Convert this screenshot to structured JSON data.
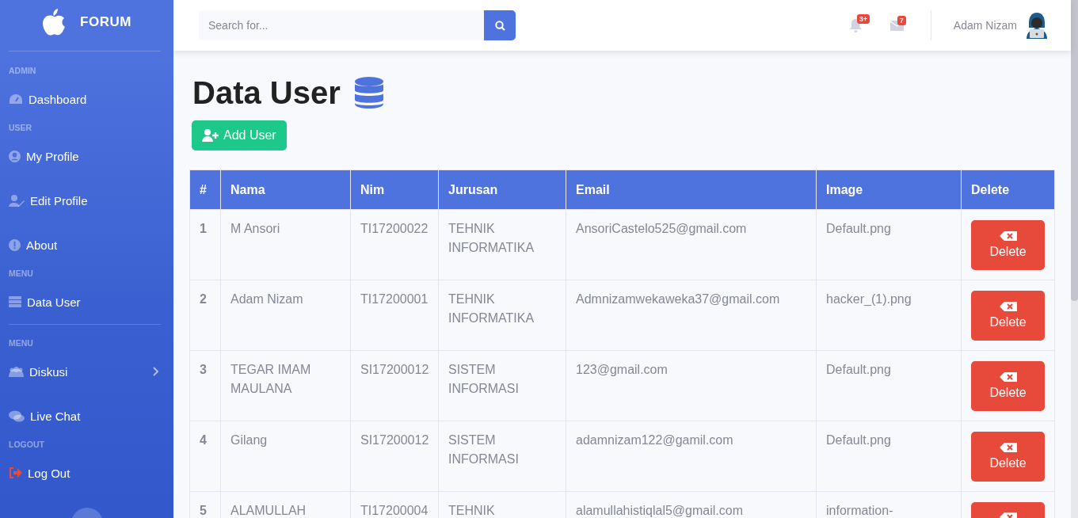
{
  "sidebar": {
    "brand": "FORUM",
    "sections": [
      {
        "heading": "ADMIN",
        "items": [
          {
            "label": "Dashboard",
            "kind": "link"
          }
        ]
      },
      {
        "heading": "USER",
        "items": [
          {
            "label": "My Profile",
            "kind": "link"
          },
          {
            "label": "Edit Profile",
            "kind": "link"
          },
          {
            "label": "About",
            "kind": "link"
          }
        ]
      },
      {
        "heading": "MENU",
        "items": [
          {
            "label": "Data User",
            "kind": "link"
          }
        ],
        "divider_after": true
      },
      {
        "heading": "MENU",
        "items": [
          {
            "label": "Diskusi",
            "kind": "collapsible"
          },
          {
            "label": "Live Chat",
            "kind": "link"
          }
        ]
      },
      {
        "heading": "LOGOUT",
        "items": [
          {
            "label": "Log Out",
            "kind": "logout"
          }
        ]
      }
    ]
  },
  "topbar": {
    "search": {
      "placeholder": "Search for..."
    },
    "alerts_badge": "3+",
    "messages_badge": "7",
    "user_name": "Adam Nizam"
  },
  "page": {
    "title": "Data User",
    "add_button": "Add User"
  },
  "table": {
    "columns": [
      "#",
      "Nama",
      "Nim",
      "Jurusan",
      "Email",
      "Image",
      "Delete"
    ],
    "rows": [
      {
        "cells": [
          "1",
          "M Ansori",
          "TI17200022",
          "TEHNIK INFORMATIKA",
          "AnsoriCastelo525@gmail.com",
          "Default.png"
        ],
        "delete_label": "Delete"
      },
      {
        "cells": [
          "2",
          "Adam Nizam",
          "TI17200001",
          "TEHNIK INFORMATIKA",
          "Admnizamwekaweka37@gmail.com",
          "hacker_(1).png"
        ],
        "delete_label": "Delete"
      },
      {
        "cells": [
          "3",
          "TEGAR IMAM MAULANA",
          "SI17200012",
          "SISTEM INFORMASI",
          "123@gmail.com",
          "Default.png"
        ],
        "delete_label": "Delete"
      },
      {
        "cells": [
          "4",
          "Gilang",
          "SI17200012",
          "SISTEM INFORMASI",
          "adamnizam122@gamil.com",
          "Default.png"
        ],
        "delete_label": "Delete"
      },
      {
        "cells": [
          "5",
          "ALAMULLAH",
          "TI17200004",
          "TEHNIK",
          "alamullahistiqlal5@gmail.com",
          "information-"
        ]
      }
    ]
  }
}
